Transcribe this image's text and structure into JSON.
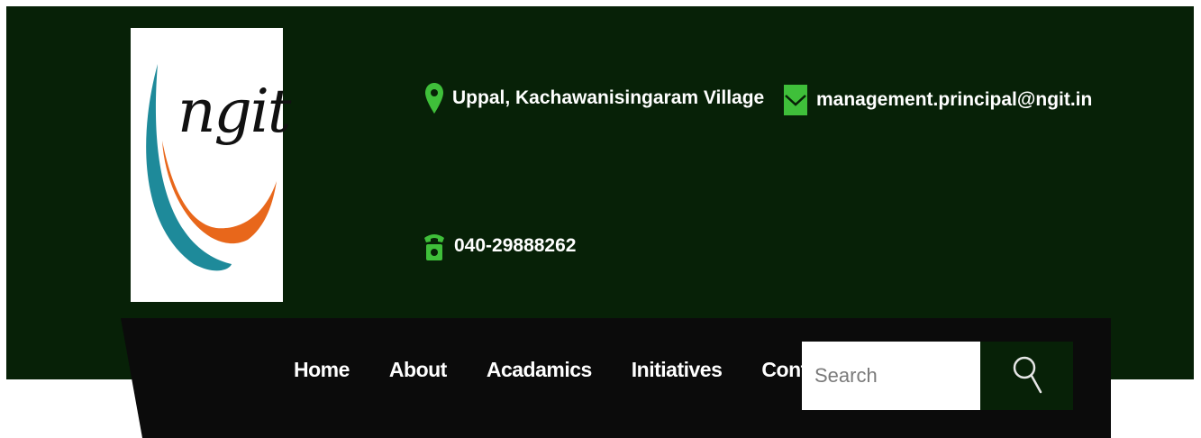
{
  "header": {
    "logo": {
      "text": "ngit",
      "icon": "ngit-logo"
    },
    "contacts": {
      "location": {
        "icon": "map-pin-icon",
        "text": "Uppal, Kachawanisingaram Village"
      },
      "email": {
        "icon": "envelope-icon",
        "text": "management.principal@ngit.in"
      },
      "phone": {
        "icon": "phone-icon",
        "text": "040-29888262"
      }
    }
  },
  "nav": {
    "items": [
      {
        "label": "Home"
      },
      {
        "label": "About"
      },
      {
        "label": "Acadamics"
      },
      {
        "label": "Initiatives"
      },
      {
        "label": "Contact Us"
      }
    ]
  },
  "search": {
    "placeholder": "Search",
    "button_icon": "search-icon"
  },
  "colors": {
    "topbar_bg": "#072107",
    "navbar_bg": "#0b0b0b",
    "icon_green": "#3fbf3a",
    "logo_orange": "#e8671b",
    "logo_teal": "#1e8a9a"
  }
}
